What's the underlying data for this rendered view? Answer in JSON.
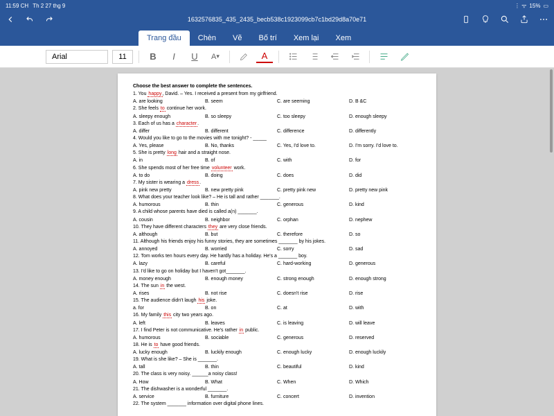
{
  "statusbar": {
    "time": "11:59 CH",
    "date": "Th 2 27 thg 9",
    "battery": "15%"
  },
  "title": "1632576835_435_2435_becb538c1923099cb7c1bd29d8a70e71",
  "tabs": {
    "t0": "Trang đầu",
    "t1": "Chèn",
    "t2": "Vẽ",
    "t3": "Bố trí",
    "t4": "Xem lại",
    "t5": "Xem"
  },
  "toolbar": {
    "font": "Arial",
    "size": "11"
  },
  "doc": {
    "heading": "Choose the best answer to complete the sentences.",
    "q1": "1. You ",
    "q1b": "happy",
    "q1c": ", David. – Yes. I received a present from my girlfriend.",
    "a1a": "A. are looking",
    "a1b": "B. seem",
    "a1c": "C. are seeming",
    "a1d": "D. B &C",
    "q2": "2. She feels ",
    "q2b": "to",
    "q2c": " continue her work.",
    "a2a": "A. sleepy enough",
    "a2b": "B. so sleepy",
    "a2c": "C. too sleepy",
    "a2d": "D. enough sleepy",
    "q3": "3. Each of us has a ",
    "q3b": "character",
    "q3c": ".",
    "a3a": "A. differ",
    "a3b": "B. different",
    "a3c": "C. difference",
    "a3d": "D. differently",
    "q4": "4. Would you like to go to the movies with me tonight? - _____",
    "a4a": "A. Yes, please",
    "a4b": "B. No, thanks",
    "a4c": "C. Yes, I'd love to.",
    "a4d": "D. I'm sorry. I'd love to.",
    "q5": "5. She is pretty ",
    "q5b": "long",
    "q5c": " hair and a straight nose.",
    "a5a": "A. in",
    "a5b": "B. of",
    "a5c": "C. with",
    "a5d": "D. for",
    "q6": "6. She spends most of her free time ",
    "q6b": "volunteer",
    "q6c": " work.",
    "a6a": "A. to do",
    "a6b": "B. doing",
    "a6c": "C. does",
    "a6d": "D. did",
    "q7": "7. My sister is wearing a ",
    "q7b": "dress",
    "q7c": ".",
    "a7a": "A. pink new pretty",
    "a7b": "B. new pretty pink",
    "a7c": "C. pretty pink new",
    "a7d": "D. pretty new pink",
    "q8": "8. What does your teacher look like? – He is tall and rather _______.",
    "a8a": "A. humorous",
    "a8b": "B. thin",
    "a8c": "C. generous",
    "a8d": "D. kind",
    "q9": "9. A child whose parents have died is called a(n) _______.",
    "a9a": "A. cousin",
    "a9b": "B. neighbor",
    "a9c": "C. orphan",
    "a9d": "D. nephew",
    "q10": "10. They have different characters ",
    "q10b": "they",
    "q10c": " are very close friends.",
    "a10a": "A. although",
    "a10b": "B. but",
    "a10c": "C. therefore",
    "a10d": "D. so",
    "q11": "11. Although his friends enjoy his funny stories, they are sometimes _______ by his jokes.",
    "a11a": "A. annoyed",
    "a11b": "B. worried",
    "a11c": "C. sorry",
    "a11d": "D. sad",
    "q12": "12. Tom works ten hours every day. He hardly has a holiday. He's a _______ boy.",
    "a12a": "A. lazy",
    "a12b": "B. careful",
    "a12c": "C. hard-working",
    "a12d": "D. generous",
    "q13": "13. I'd like to go on holiday but I haven't got_______.",
    "a13a": "A. money enough",
    "a13b": "B. enough money",
    "a13c": "C. strong enough",
    "a13d": "D. enough strong",
    "q14": "14. The sun ",
    "q14b": "in",
    "q14c": " the west.",
    "a14a": "A. rises",
    "a14b": "B. not rise",
    "a14c": "C. doesn't rise",
    "a14d": "D. rise",
    "q15": "15. The audience didn't laugh ",
    "q15b": "his",
    "q15c": " joke.",
    "a15a": "a. for",
    "a15b": "B. on",
    "a15c": "C. at",
    "a15d": "D. with",
    "q16": "16. My family ",
    "q16b": "this",
    "q16c": " city two years ago.",
    "a16a": "A. left",
    "a16b": "B. leaves",
    "a16c": "C. is leaving",
    "a16d": "D. will leave",
    "q17": "17. I find Peter is not communicative. He's rather ",
    "q17b": "in",
    "q17c": " public.",
    "a17a": "A. humorous",
    "a17b": "B. sociable",
    "a17c": "C. generous",
    "a17d": "D. reserved",
    "q18": "18. He is ",
    "q18b": "to",
    "q18c": " have good friends.",
    "a18a": "A. lucky enough",
    "a18b": "B. luckily enough",
    "a18c": "C. enough lucky",
    "a18d": "D. enough luckily",
    "q19": "19. What is she like? – She is _______.",
    "a19a": "A. tall",
    "a19b": "B. thin",
    "a19c": "C. beautiful",
    "a19d": "D. kind",
    "q20": "20. The class is very noisy. ______a noisy class!",
    "a20a": "A. How",
    "a20b": "B. What",
    "a20c": "C. When",
    "a20d": "D. Which",
    "q21": "21. The dishwasher is a wonderful _______.",
    "a21a": "A. service",
    "a21b": "B. furniture",
    "a21c": "C. concert",
    "a21d": "D. invention",
    "q22": "22. The system _______ information over digital phone lines."
  }
}
